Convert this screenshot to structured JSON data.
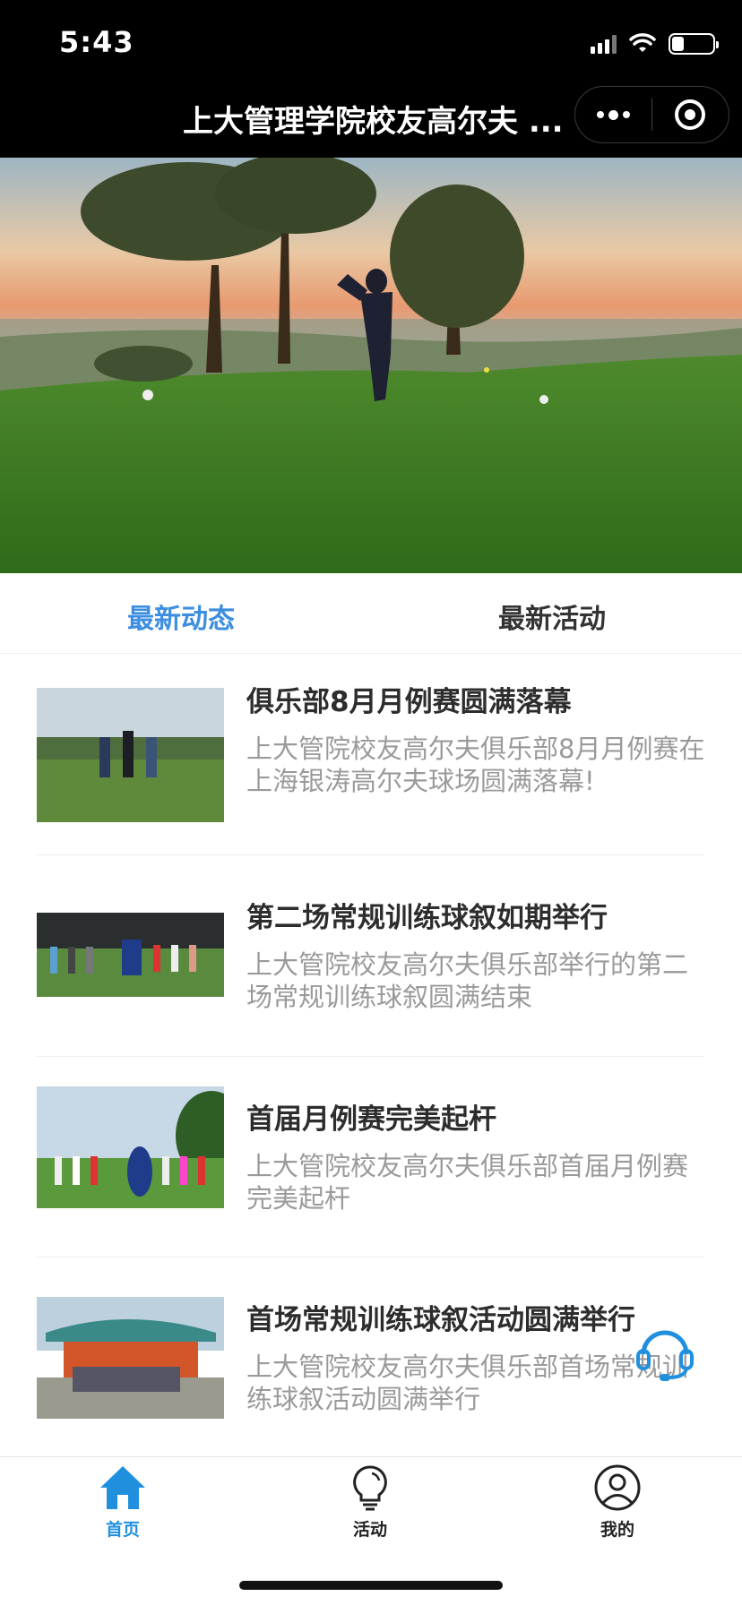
{
  "status_bar": {
    "time": "5:43"
  },
  "nav": {
    "title": "上大管理学院校友高尔夫 ..."
  },
  "colors": {
    "accent": "#3d8ee0",
    "nav_bg": "#000000",
    "text_primary": "#2d2d2d",
    "text_secondary": "#9a9a9a"
  },
  "tabs": [
    {
      "label": "最新动态",
      "active": true
    },
    {
      "label": "最新活动",
      "active": false
    }
  ],
  "news": [
    {
      "title": "俱乐部8月月例赛圆满落幕",
      "desc": "上大管院校友高尔夫俱乐部8月月例赛在上海银涛高尔夫球场圆满落幕!"
    },
    {
      "title": "第二场常规训练球叙如期举行",
      "desc": "上大管院校友高尔夫俱乐部举行的第二场常规训练球叙圆满结束"
    },
    {
      "title": "首届月例赛完美起杆",
      "desc": "上大管院校友高尔夫俱乐部首届月例赛完美起杆"
    },
    {
      "title": "首场常规训练球叙活动圆满举行",
      "desc": "上大管院校友高尔夫俱乐部首场常规训练球叙活动圆满举行"
    }
  ],
  "tabbar": [
    {
      "label": "首页",
      "icon": "home-icon",
      "active": true
    },
    {
      "label": "活动",
      "icon": "lightbulb-icon",
      "active": false
    },
    {
      "label": "我的",
      "icon": "user-icon",
      "active": false
    }
  ],
  "floating": {
    "icon": "headset-icon"
  }
}
